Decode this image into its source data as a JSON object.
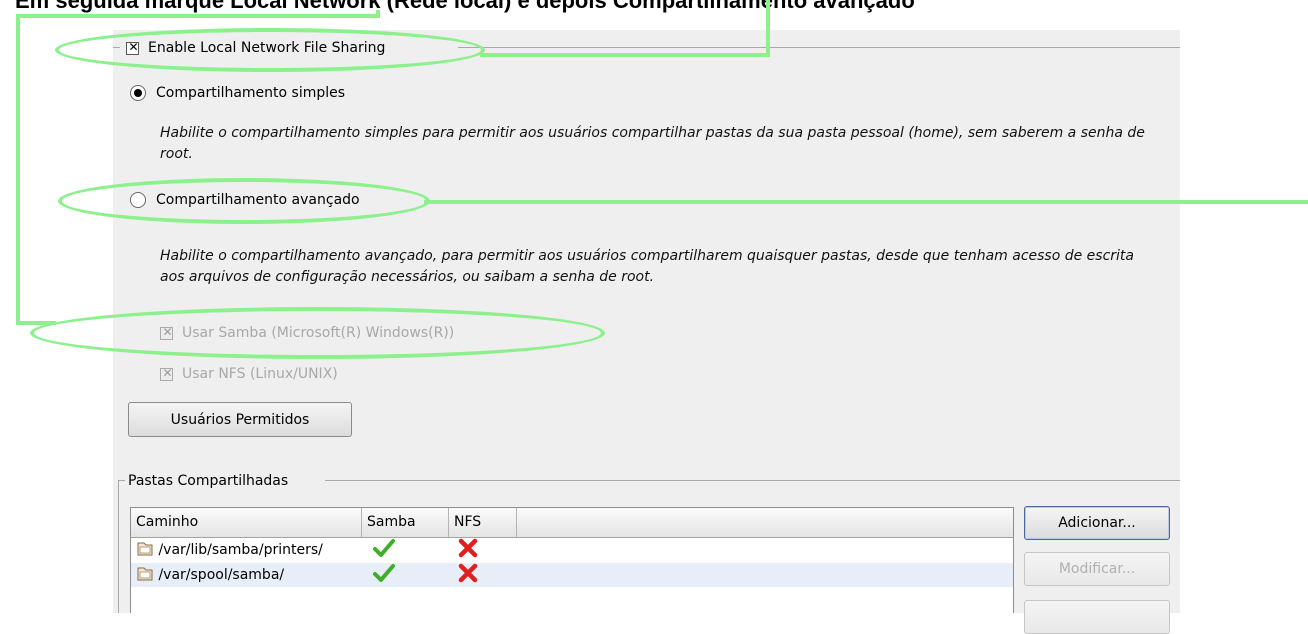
{
  "caption": {
    "text": "Em seguida marque Local Network (Rede local) e depois Compartilhamento avançado"
  },
  "sharing": {
    "enable_label": "Enable Local Network File Sharing",
    "enable_checked": true,
    "simple": {
      "label": "Compartilhamento simples",
      "selected": true,
      "description": "Habilite o compartilhamento simples para permitir aos usuários compartilhar pastas da sua pasta pessoal (home), sem saberem a senha de root."
    },
    "advanced": {
      "label": "Compartilhamento avançado",
      "selected": false,
      "description": "Habilite o compartilhamento avançado, para permitir aos usuários compartilharem quaisquer pastas, desde que tenham acesso de escrita aos arquivos de configuração necessários, ou saibam a senha de root."
    },
    "use_samba": {
      "label": "Usar Samba (Microsoft(R) Windows(R))",
      "checked": true,
      "enabled": false
    },
    "use_nfs": {
      "label": "Usar NFS (Linux/UNIX)",
      "checked": true,
      "enabled": false
    },
    "allowed_users_button": "Usuários Permitidos"
  },
  "shared_folders": {
    "title": "Pastas Compartilhadas",
    "columns": [
      "Caminho",
      "Samba",
      "NFS"
    ],
    "rows": [
      {
        "path": "/var/lib/samba/printers/",
        "samba": true,
        "nfs": false
      },
      {
        "path": "/var/spool/samba/",
        "samba": true,
        "nfs": false
      }
    ],
    "buttons": {
      "add": "Adicionar...",
      "modify": "Modificar..."
    }
  },
  "colors": {
    "highlight": "#8cf08c",
    "panel": "#efefef",
    "check_green": "#3fae2a",
    "cross_red": "#e02020"
  },
  "icons": {
    "folder": "folder-icon",
    "check": "check-icon",
    "cross": "cross-icon"
  }
}
